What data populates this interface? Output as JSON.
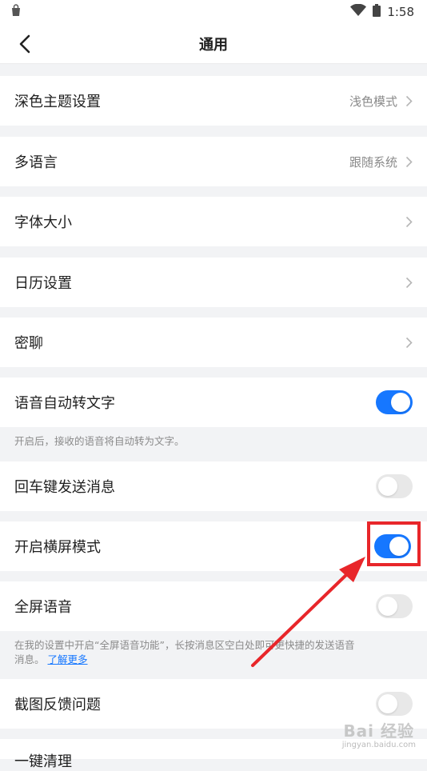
{
  "status_bar": {
    "time": "1:58"
  },
  "header": {
    "title": "通用"
  },
  "rows": {
    "dark_theme": {
      "label": "深色主题设置",
      "value": "浅色模式"
    },
    "language": {
      "label": "多语言",
      "value": "跟随系统"
    },
    "font_size": {
      "label": "字体大小"
    },
    "calendar": {
      "label": "日历设置"
    },
    "secret_chat": {
      "label": "密聊"
    },
    "voice_to_text": {
      "label": "语音自动转文字",
      "on": true,
      "desc": "开启后，接收的语音将自动转为文字。"
    },
    "enter_send": {
      "label": "回车键发送消息",
      "on": false
    },
    "landscape": {
      "label": "开启横屏模式",
      "on": true
    },
    "fullscreen_voice": {
      "label": "全屏语音",
      "on": false,
      "desc_line1": "在我的设置中开启“全屏语音功能”，长按消息区空白处即可更快捷的发送语音",
      "desc_line2": "消息。",
      "desc_link": "了解更多"
    },
    "screenshot_feedback": {
      "label": "截图反馈问题",
      "on": false
    },
    "one_click_clean": {
      "label": "一键清理"
    }
  },
  "colors": {
    "accent": "#1677ff",
    "highlight": "#e8262a"
  },
  "watermark": {
    "text": "Bai 经验",
    "sub": "jingyan.baidu.com"
  }
}
